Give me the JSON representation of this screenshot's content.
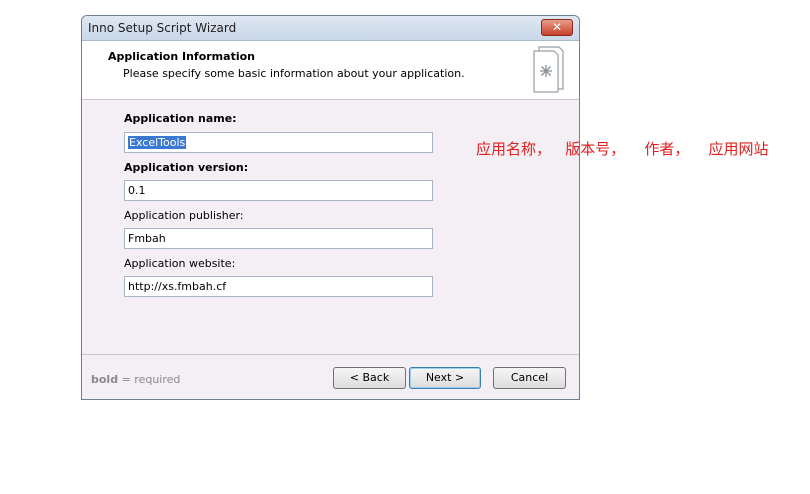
{
  "window": {
    "title": "Inno Setup Script Wizard",
    "close_label": "✕"
  },
  "header": {
    "title": "Application Information",
    "subtitle": "Please specify some basic information about your application."
  },
  "fields": [
    {
      "label": "Application name:",
      "value": "ExcelTools",
      "bold": true,
      "selected": true
    },
    {
      "label": "Application version:",
      "value": "0.1",
      "bold": true
    },
    {
      "label": "Application publisher:",
      "value": "Fmbah",
      "bold": false
    },
    {
      "label": "Application website:",
      "value": "http://xs.fmbah.cf",
      "bold": false
    }
  ],
  "footer": {
    "legend_bold": "bold",
    "legend_rest": " = required",
    "back_label": "< Back",
    "next_label": "Next >",
    "cancel_label": "Cancel"
  },
  "annotation": "应用名称，   版本号，    作者，    应用网站",
  "colors": {
    "annotation": "#e0201f",
    "selection": "#3a79d1"
  }
}
